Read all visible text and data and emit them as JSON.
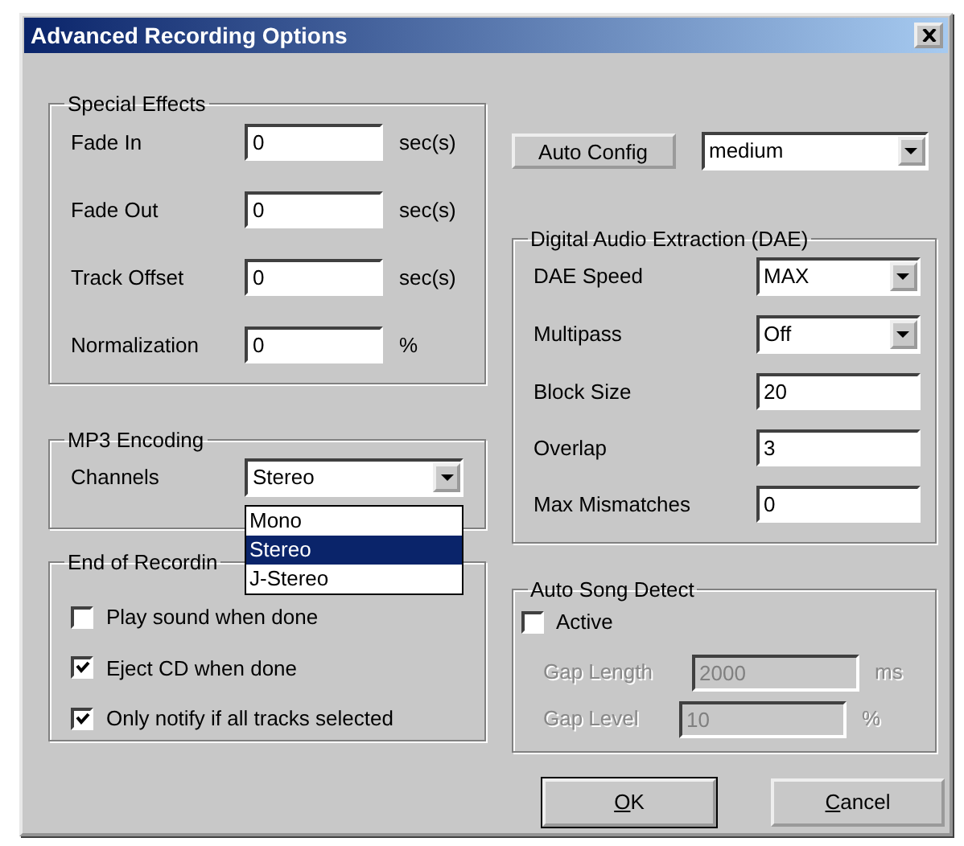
{
  "window": {
    "title": "Advanced Recording Options"
  },
  "special_effects": {
    "title": "Special Effects",
    "fields": [
      {
        "label": "Fade In",
        "value": "0",
        "unit": "sec(s)"
      },
      {
        "label": "Fade Out",
        "value": "0",
        "unit": "sec(s)"
      },
      {
        "label": "Track Offset",
        "value": "0",
        "unit": "sec(s)"
      },
      {
        "label": "Normalization",
        "value": "0",
        "unit": "%"
      }
    ]
  },
  "auto_config": {
    "button": "Auto Config",
    "preset": "medium"
  },
  "dae": {
    "title": "Digital Audio Extraction (DAE)",
    "fields": [
      {
        "kind": "combo",
        "label": "DAE Speed",
        "value": "MAX"
      },
      {
        "kind": "combo",
        "label": "Multipass",
        "value": "Off"
      },
      {
        "kind": "input",
        "label": "Block Size",
        "value": "20"
      },
      {
        "kind": "input",
        "label": "Overlap",
        "value": "3"
      },
      {
        "kind": "input",
        "label": "Max Mismatches",
        "value": "0"
      }
    ]
  },
  "mp3_encoding": {
    "title": "MP3 Encoding",
    "channels": {
      "label": "Channels",
      "value": "Stereo",
      "expanded": true,
      "options": [
        {
          "label": "Mono",
          "selected": false
        },
        {
          "label": "Stereo",
          "selected": true
        },
        {
          "label": "J-Stereo",
          "selected": false
        }
      ]
    }
  },
  "end_of_recording": {
    "title": "End of Recordin",
    "options": [
      {
        "label": "Play sound when done",
        "checked": false
      },
      {
        "label": "Eject CD when done",
        "checked": true
      },
      {
        "label": "Only notify if all tracks selected",
        "checked": true
      }
    ]
  },
  "auto_song_detect": {
    "title": "Auto Song Detect",
    "active": {
      "label": "Active",
      "checked": false
    },
    "fields": [
      {
        "label": "Gap Length",
        "value": "2000",
        "unit": "ms",
        "disabled": true
      },
      {
        "label": "Gap Level",
        "value": "10",
        "unit": "%",
        "disabled": true
      }
    ]
  },
  "buttons": [
    {
      "label": "OK",
      "default": true
    },
    {
      "label": "Cancel",
      "default": false
    }
  ]
}
